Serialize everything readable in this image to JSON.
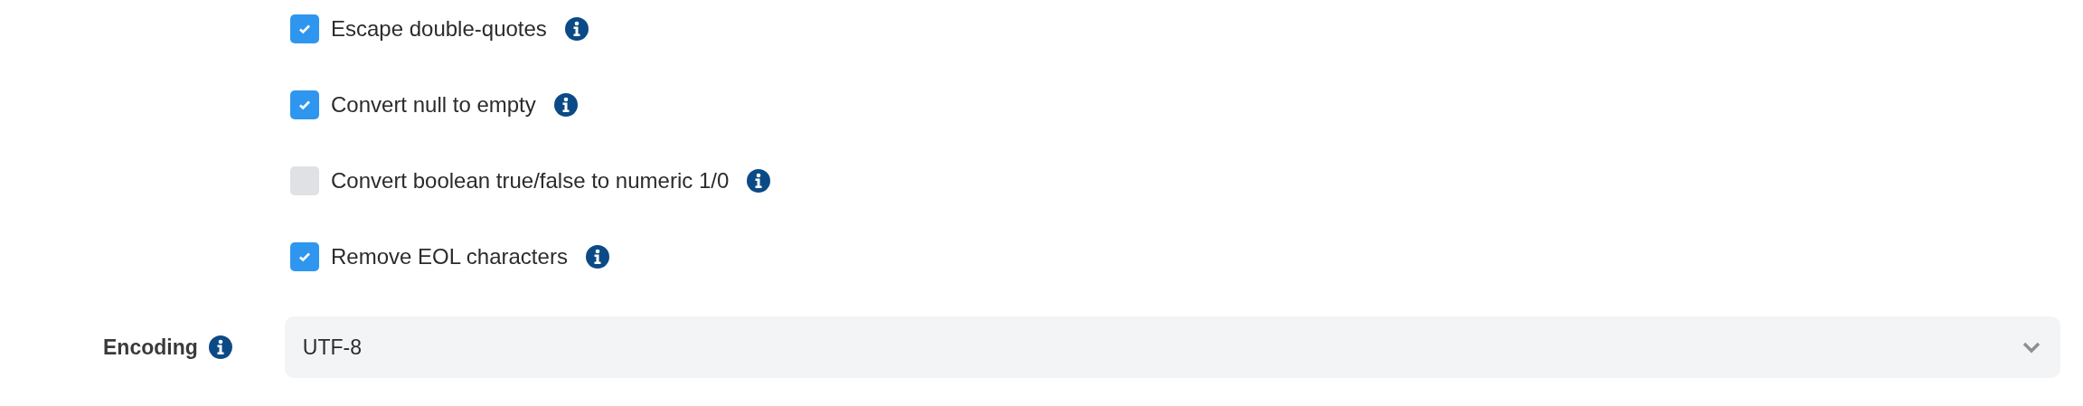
{
  "options": [
    {
      "label": "Escape double-quotes",
      "checked": true
    },
    {
      "label": "Convert null to empty",
      "checked": true
    },
    {
      "label": "Convert boolean true/false to numeric 1/0",
      "checked": false
    },
    {
      "label": "Remove EOL characters",
      "checked": true
    }
  ],
  "encoding": {
    "label": "Encoding",
    "value": "UTF-8"
  }
}
